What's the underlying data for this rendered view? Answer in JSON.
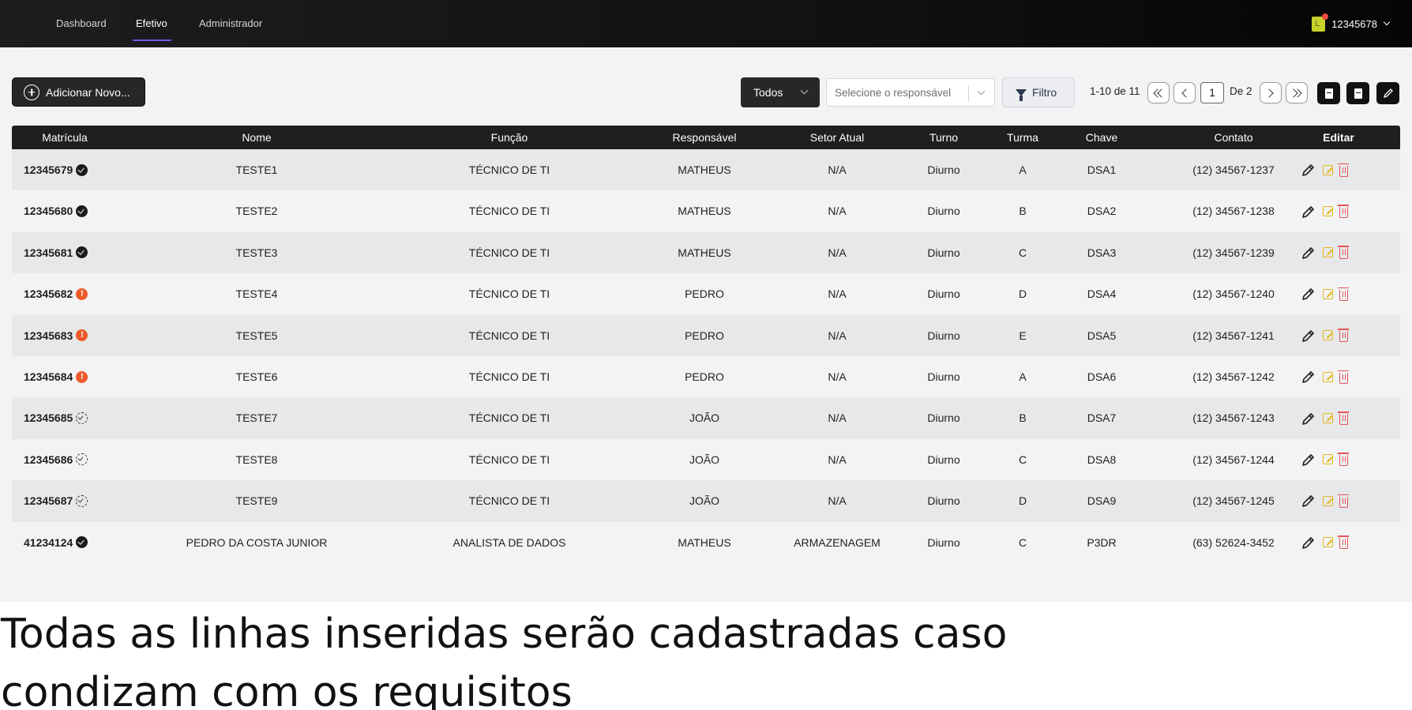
{
  "nav": {
    "items": [
      {
        "label": "Dashboard"
      },
      {
        "label": "Efetivo"
      },
      {
        "label": "Administrador"
      }
    ],
    "active_index": 1,
    "user_label": "12345678"
  },
  "toolbar": {
    "add_label": "Adicionar Novo...",
    "status_select_value": "Todos",
    "responsavel_placeholder": "Selecione o responsável",
    "filter_label": "Filtro",
    "range_text": "1-10 de 11",
    "current_page": "1",
    "total_pages_text": "De 2"
  },
  "table": {
    "headers": {
      "matricula": "Matrícula",
      "nome": "Nome",
      "funcao": "Função",
      "responsavel": "Responsável",
      "setor": "Setor Atual",
      "turno": "Turno",
      "turma": "Turma",
      "chave": "Chave",
      "contato": "Contato",
      "editar": "Editar"
    },
    "rows": [
      {
        "matricula": "12345679",
        "status": "verified",
        "nome": "TESTE1",
        "funcao": "TÉCNICO DE TI",
        "responsavel": "MATHEUS",
        "setor": "N/A",
        "turno": "Diurno",
        "turma": "A",
        "chave": "DSA1",
        "contato": "(12) 34567-1237"
      },
      {
        "matricula": "12345680",
        "status": "verified",
        "nome": "TESTE2",
        "funcao": "TÉCNICO DE TI",
        "responsavel": "MATHEUS",
        "setor": "N/A",
        "turno": "Diurno",
        "turma": "B",
        "chave": "DSA2",
        "contato": "(12) 34567-1238"
      },
      {
        "matricula": "12345681",
        "status": "verified",
        "nome": "TESTE3",
        "funcao": "TÉCNICO DE TI",
        "responsavel": "MATHEUS",
        "setor": "N/A",
        "turno": "Diurno",
        "turma": "C",
        "chave": "DSA3",
        "contato": "(12) 34567-1239"
      },
      {
        "matricula": "12345682",
        "status": "warning",
        "nome": "TESTE4",
        "funcao": "TÉCNICO DE TI",
        "responsavel": "PEDRO",
        "setor": "N/A",
        "turno": "Diurno",
        "turma": "D",
        "chave": "DSA4",
        "contato": "(12) 34567-1240"
      },
      {
        "matricula": "12345683",
        "status": "warning",
        "nome": "TESTE5",
        "funcao": "TÉCNICO DE TI",
        "responsavel": "PEDRO",
        "setor": "N/A",
        "turno": "Diurno",
        "turma": "E",
        "chave": "DSA5",
        "contato": "(12) 34567-1241"
      },
      {
        "matricula": "12345684",
        "status": "warning",
        "nome": "TESTE6",
        "funcao": "TÉCNICO DE TI",
        "responsavel": "PEDRO",
        "setor": "N/A",
        "turno": "Diurno",
        "turma": "A",
        "chave": "DSA6",
        "contato": "(12) 34567-1242"
      },
      {
        "matricula": "12345685",
        "status": "pending",
        "nome": "TESTE7",
        "funcao": "TÉCNICO DE TI",
        "responsavel": "JOÃO",
        "setor": "N/A",
        "turno": "Diurno",
        "turma": "B",
        "chave": "DSA7",
        "contato": "(12) 34567-1243"
      },
      {
        "matricula": "12345686",
        "status": "pending",
        "nome": "TESTE8",
        "funcao": "TÉCNICO DE TI",
        "responsavel": "JOÃO",
        "setor": "N/A",
        "turno": "Diurno",
        "turma": "C",
        "chave": "DSA8",
        "contato": "(12) 34567-1244"
      },
      {
        "matricula": "12345687",
        "status": "pending",
        "nome": "TESTE9",
        "funcao": "TÉCNICO DE TI",
        "responsavel": "JOÃO",
        "setor": "N/A",
        "turno": "Diurno",
        "turma": "D",
        "chave": "DSA9",
        "contato": "(12) 34567-1245"
      },
      {
        "matricula": "41234124",
        "status": "verified",
        "nome": "PEDRO DA COSTA JUNIOR",
        "funcao": "ANALISTA DE DADOS",
        "responsavel": "MATHEUS",
        "setor": "ARMAZENAGEM",
        "turno": "Diurno",
        "turma": "C",
        "chave": "P3DR",
        "contato": "(63) 52624-3452"
      }
    ]
  },
  "caption": {
    "text": "Todas as linhas inseridas serão cadastradas caso condizam com os requisitos"
  },
  "colors": {
    "accent": "#6d5de8",
    "edit_icon": "#e5b818",
    "delete_icon": "#e55353",
    "warning_badge": "#ec5a2a"
  },
  "icons": {
    "user": "user-badge-icon",
    "add": "plus-circle-icon",
    "filter": "funnel-icon",
    "first": "chevrons-left-icon",
    "prev": "chevron-left-icon",
    "next": "chevron-right-icon",
    "last": "chevrons-right-icon",
    "import": "file-import-icon",
    "export": "file-export-icon",
    "bulk_edit": "pencil-icon",
    "row_edit": "pencil-icon",
    "row_quick_edit": "edit-square-icon",
    "row_delete": "trash-icon",
    "status_verified": "verified-badge-icon",
    "status_warning": "warning-badge-icon",
    "status_pending": "pending-badge-icon"
  }
}
